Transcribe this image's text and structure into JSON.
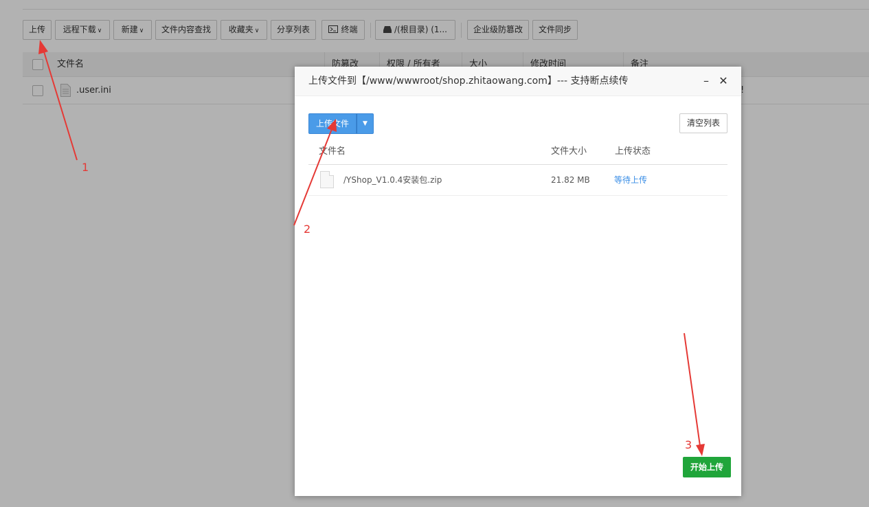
{
  "toolbar": {
    "buttons": [
      {
        "label": "上传"
      },
      {
        "label": "远程下载"
      },
      {
        "label": "新建"
      },
      {
        "label": "文件内容查找"
      },
      {
        "label": "收藏夹"
      },
      {
        "label": "分享列表"
      },
      {
        "label": "终端"
      },
      {
        "label": "/(根目录) (1..."
      },
      {
        "label": "企业级防篡改"
      },
      {
        "label": "文件同步"
      }
    ]
  },
  "file_table": {
    "columns": [
      "文件名",
      "防篡改",
      "权限 / 所有者",
      "大小",
      "修改时间",
      "备注"
    ],
    "rows": [
      {
        "name": ".user.ini",
        "note_fragment": "!"
      }
    ]
  },
  "upload_dialog": {
    "title": "上传文件到【/www/wwwroot/shop.zhitaowang.com】--- 支持断点续传",
    "upload_button": "上传文件",
    "clear_button": "清空列表",
    "columns": {
      "name": "文件名",
      "size": "文件大小",
      "status": "上传状态"
    },
    "files": [
      {
        "name": "/YShop_V1.0.4安装包.zip",
        "size": "21.82 MB",
        "status": "等待上传"
      }
    ],
    "start_button": "开始上传"
  },
  "annotations": {
    "labels": [
      "1",
      "2",
      "3"
    ],
    "color": "#e53935"
  },
  "colors": {
    "primary_blue": "#4a9be8",
    "start_green": "#20a53a",
    "status_link": "#3a8ee6"
  }
}
